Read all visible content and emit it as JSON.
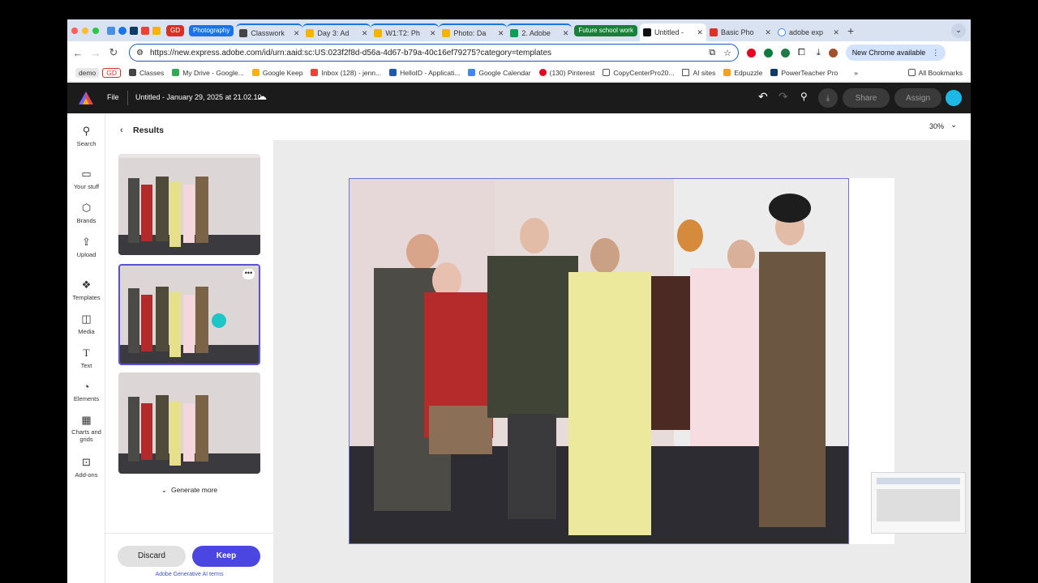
{
  "browser": {
    "tabs": [
      {
        "label": "GD",
        "type": "group",
        "color": "#d93025"
      },
      {
        "label": "Photography",
        "type": "group",
        "color": "#1a73e8"
      },
      {
        "label": "Classwork",
        "type": "tab"
      },
      {
        "label": "Day 3: Ad",
        "type": "tab"
      },
      {
        "label": "W1:T2: Ph",
        "type": "tab"
      },
      {
        "label": "Photo: Da",
        "type": "tab"
      },
      {
        "label": "2. Adobe",
        "type": "tab"
      },
      {
        "label": "Future school work",
        "type": "group",
        "color": "#188038"
      },
      {
        "label": "Untitled -",
        "type": "tab",
        "active": true
      },
      {
        "label": "Basic Pho",
        "type": "tab"
      },
      {
        "label": "adobe exp",
        "type": "tab"
      }
    ],
    "url": "https://new.express.adobe.com/id/urn:aaid:sc:US:023f2f8d-d56a-4d67-b79a-40c16ef79275?category=templates",
    "new_chrome_label": "New Chrome available",
    "bookmarks": [
      {
        "label": "demo",
        "icon": "group-chip"
      },
      {
        "label": "GD",
        "icon": "group-chip"
      },
      {
        "label": "Classes",
        "icon": "classroom-icon"
      },
      {
        "label": "My Drive - Google...",
        "icon": "drive-icon"
      },
      {
        "label": "Google Keep",
        "icon": "keep-icon"
      },
      {
        "label": "Inbox (128) - jenn...",
        "icon": "gmail-icon"
      },
      {
        "label": "HelloID - Applicati...",
        "icon": "helloid-icon"
      },
      {
        "label": "Google Calendar",
        "icon": "calendar-icon"
      },
      {
        "label": "(130) Pinterest",
        "icon": "pinterest-icon"
      },
      {
        "label": "CopyCenterPro20...",
        "icon": "copy-icon"
      },
      {
        "label": "AI sites",
        "icon": "folder-icon"
      },
      {
        "label": "Edpuzzle",
        "icon": "edpuzzle-icon"
      },
      {
        "label": "PowerTeacher Pro",
        "icon": "sis-icon"
      }
    ],
    "all_bookmarks_label": "All Bookmarks"
  },
  "app": {
    "file_label": "File",
    "doc_title": "Untitled - January 29, 2025 at 21.02.10",
    "share_label": "Share",
    "assign_label": "Assign",
    "zoom": "30%"
  },
  "rail": [
    {
      "label": "Search",
      "icon": "search-icon"
    },
    {
      "label": "Your stuff",
      "icon": "folder-icon"
    },
    {
      "label": "Brands",
      "icon": "brand-icon"
    },
    {
      "label": "Upload",
      "icon": "upload-icon"
    },
    {
      "label": "Templates",
      "icon": "templates-icon"
    },
    {
      "label": "Media",
      "icon": "media-icon"
    },
    {
      "label": "Text",
      "icon": "text-icon"
    },
    {
      "label": "Elements",
      "icon": "elements-icon"
    },
    {
      "label": "Charts and grids",
      "icon": "chart-icon"
    },
    {
      "label": "Add-ons",
      "icon": "addons-icon"
    }
  ],
  "panel": {
    "title": "Results",
    "generate_more": "Generate more",
    "discard": "Discard",
    "keep": "Keep",
    "terms": "Adobe Generative AI terms"
  },
  "colors": {
    "accent": "#4b46e1",
    "selection": "#5a52d5"
  }
}
